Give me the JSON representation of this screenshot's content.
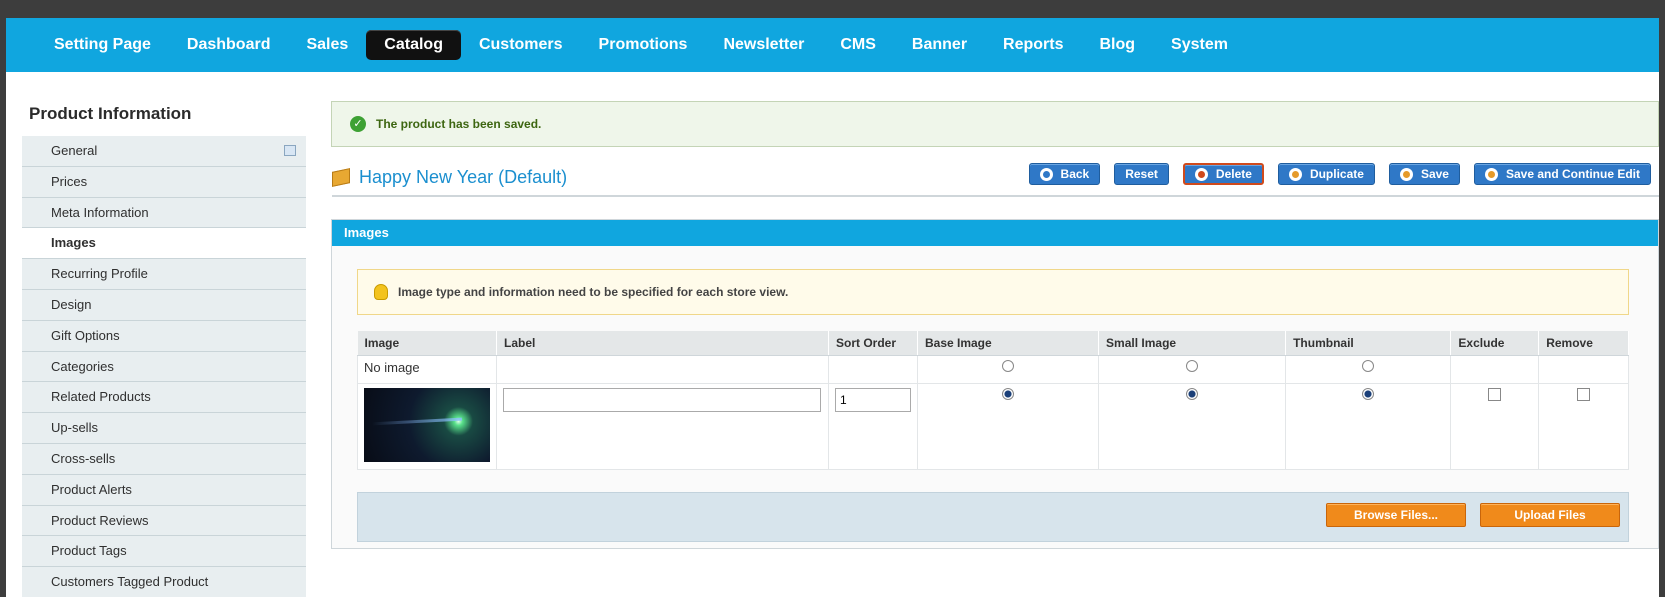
{
  "nav": {
    "items": [
      {
        "label": "Setting Page",
        "active": false
      },
      {
        "label": "Dashboard",
        "active": false
      },
      {
        "label": "Sales",
        "active": false
      },
      {
        "label": "Catalog",
        "active": true
      },
      {
        "label": "Customers",
        "active": false
      },
      {
        "label": "Promotions",
        "active": false
      },
      {
        "label": "Newsletter",
        "active": false
      },
      {
        "label": "CMS",
        "active": false
      },
      {
        "label": "Banner",
        "active": false
      },
      {
        "label": "Reports",
        "active": false
      },
      {
        "label": "Blog",
        "active": false
      },
      {
        "label": "System",
        "active": false
      }
    ]
  },
  "sidebar": {
    "title": "Product Information",
    "items": [
      {
        "label": "General",
        "active": false,
        "badge": true
      },
      {
        "label": "Prices",
        "active": false
      },
      {
        "label": "Meta Information",
        "active": false
      },
      {
        "label": "Images",
        "active": true
      },
      {
        "label": "Recurring Profile",
        "active": false
      },
      {
        "label": "Design",
        "active": false
      },
      {
        "label": "Gift Options",
        "active": false
      },
      {
        "label": "Categories",
        "active": false
      },
      {
        "label": "Related Products",
        "active": false
      },
      {
        "label": "Up-sells",
        "active": false
      },
      {
        "label": "Cross-sells",
        "active": false
      },
      {
        "label": "Product Alerts",
        "active": false
      },
      {
        "label": "Product Reviews",
        "active": false
      },
      {
        "label": "Product Tags",
        "active": false
      },
      {
        "label": "Customers Tagged Product",
        "active": false
      }
    ]
  },
  "message": {
    "success": "The product has been saved."
  },
  "product": {
    "title": "Happy New Year (Default)"
  },
  "toolbar": {
    "back": "Back",
    "reset": "Reset",
    "delete": "Delete",
    "duplicate": "Duplicate",
    "save": "Save",
    "save_continue": "Save and Continue Edit"
  },
  "images_panel": {
    "title": "Images",
    "notice": "Image type and information need to be specified for each store view.",
    "columns": [
      "Image",
      "Label",
      "Sort Order",
      "Base Image",
      "Small Image",
      "Thumbnail",
      "Exclude",
      "Remove"
    ],
    "no_image_label": "No image",
    "row": {
      "label_value": "",
      "sort_order": "1"
    },
    "browse": "Browse Files...",
    "upload": "Upload Files"
  },
  "colors": {
    "accent": "#10a6df",
    "button": "#2f78c7",
    "upload": "#f08a1b"
  }
}
